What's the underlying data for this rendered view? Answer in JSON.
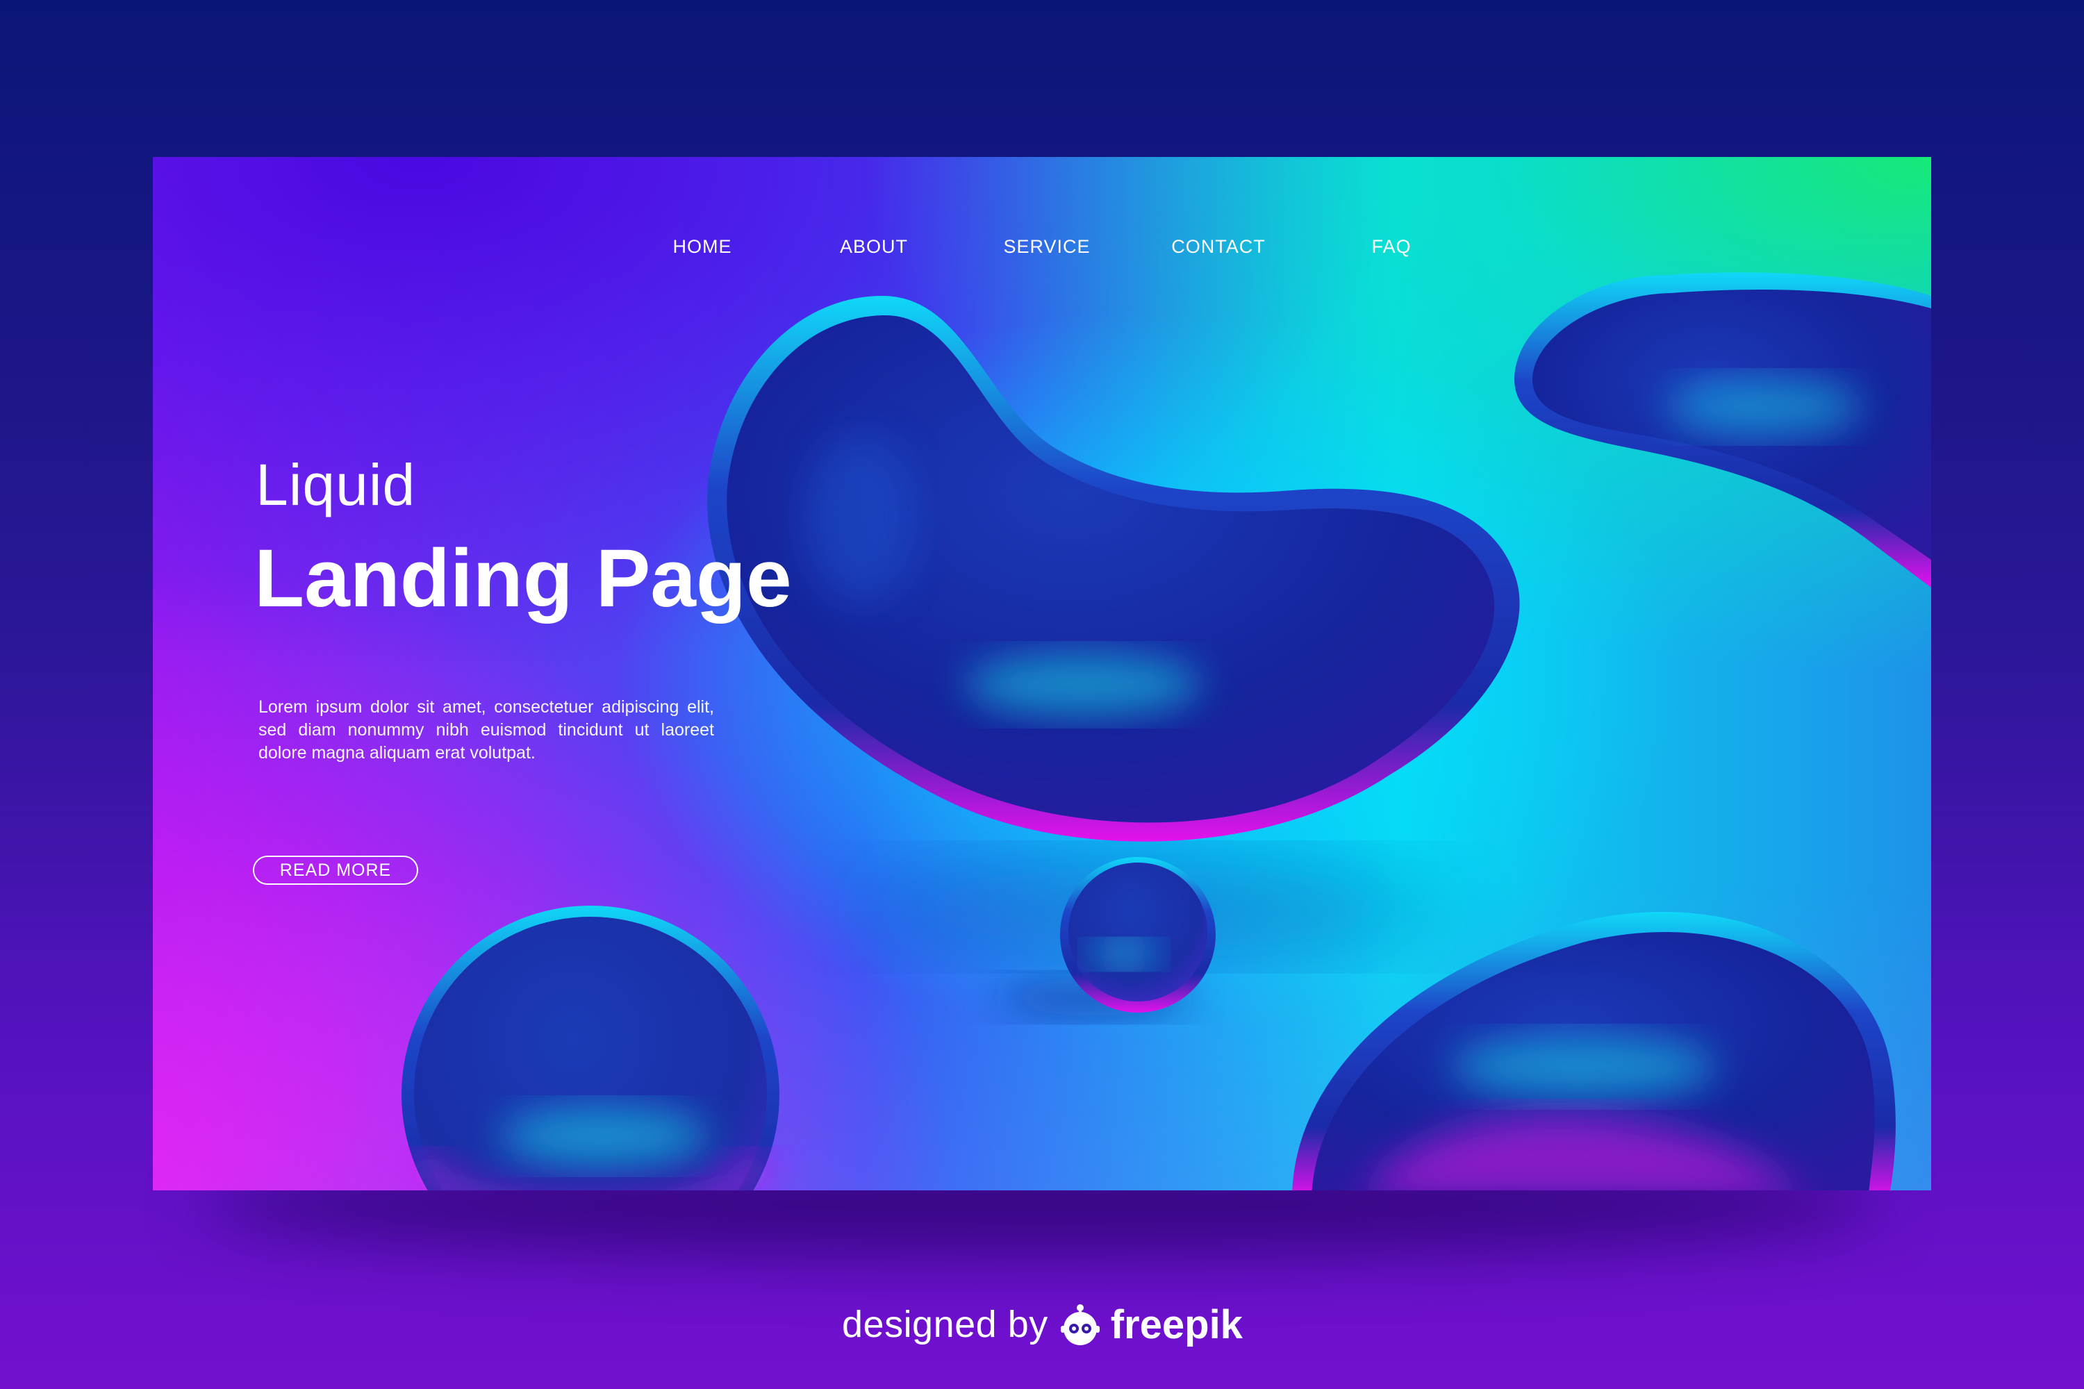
{
  "nav": {
    "items": [
      {
        "label": "HOME"
      },
      {
        "label": "ABOUT"
      },
      {
        "label": "SERVICE"
      },
      {
        "label": "CONTACT"
      },
      {
        "label": "FAQ"
      }
    ]
  },
  "hero": {
    "subtitle": "Liquid",
    "title": "Landing Page",
    "body": "Lorem ipsum dolor sit amet, consectetuer adipiscing elit, sed diam nonummy nibh euismod tincidunt ut laoreet dolore magna aliquam erat volutpat.",
    "button_label": "READ MORE"
  },
  "credit": {
    "prefix": "designed by",
    "brand": "freepik",
    "logo_icon": "freepik-logo-icon"
  },
  "colors": {
    "page_top": "#0a1677",
    "page_bottom": "#7310d0",
    "accent_magenta": "#ff10f0",
    "accent_cyan": "#08d6f2",
    "accent_green": "#16ea78",
    "text": "#ffffff"
  }
}
